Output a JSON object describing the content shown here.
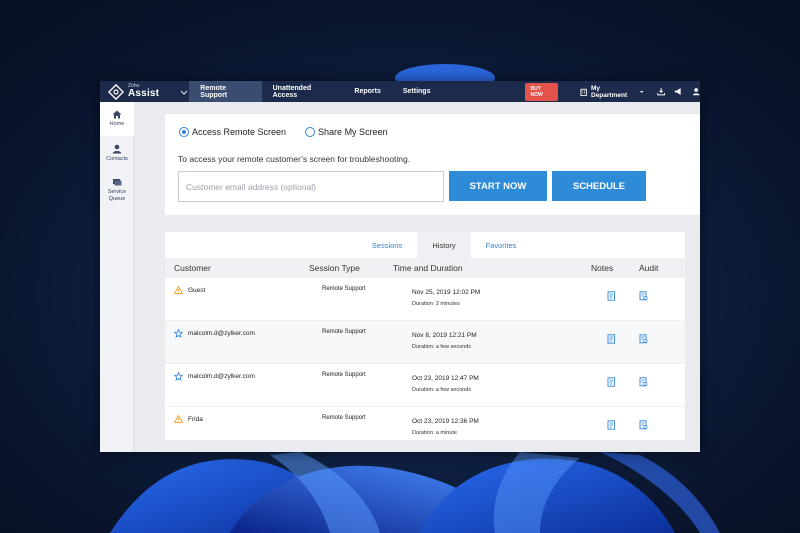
{
  "brand": {
    "small": "Zoho",
    "name": "Assist"
  },
  "topnav": {
    "tabs": [
      {
        "label": "Remote Support"
      },
      {
        "label": "Unattended Access"
      },
      {
        "label": "Reports"
      },
      {
        "label": "Settings"
      }
    ],
    "active_tab": "Remote Support",
    "buy_label": "BUY NOW",
    "department": "My Department"
  },
  "sidebar": {
    "items": [
      {
        "label": "Home"
      },
      {
        "label": "Contacts"
      },
      {
        "label": "Service Queue"
      }
    ]
  },
  "session": {
    "option_access": "Access Remote Screen",
    "option_share": "Share My Screen",
    "selected": "Access Remote Screen",
    "description": "To access your remote customer’s screen for troubleshooting.",
    "email_placeholder": "Customer email address (optional)",
    "start_label": "START NOW",
    "schedule_label": "SCHEDULE"
  },
  "history": {
    "tabs": [
      {
        "label": "Sessions"
      },
      {
        "label": "History"
      },
      {
        "label": "Favorites"
      }
    ],
    "active_tab": "History",
    "columns": {
      "customer": "Customer",
      "session_type": "Session Type",
      "time_duration": "Time and Duration",
      "notes": "Notes",
      "audit": "Audit"
    },
    "rows": [
      {
        "icon": "warning-icon",
        "customer": "Guest",
        "session_type": "Remote Support",
        "date": "Nov 25, 2019 12:02 PM",
        "duration": "Duration: 2 minutes"
      },
      {
        "icon": "star-icon",
        "customer": "malcolm.d@zylker.com",
        "session_type": "Remote Support",
        "date": "Nov 8, 2019 12:21 PM",
        "duration": "Duration: a few seconds"
      },
      {
        "icon": "star-icon",
        "customer": "malcolm.d@zylker.com",
        "session_type": "Remote Support",
        "date": "Oct 23, 2019 12:47 PM",
        "duration": "Duration: a few seconds"
      },
      {
        "icon": "warning-icon",
        "customer": "Frida",
        "session_type": "Remote Support",
        "date": "Oct 23, 2019 12:36 PM",
        "duration": "Duration: a minute"
      }
    ]
  },
  "colors": {
    "topbar": "#1c2b4b",
    "accent": "#2d8bd8",
    "buy": "#e3524b",
    "warning": "#f0a02c"
  }
}
